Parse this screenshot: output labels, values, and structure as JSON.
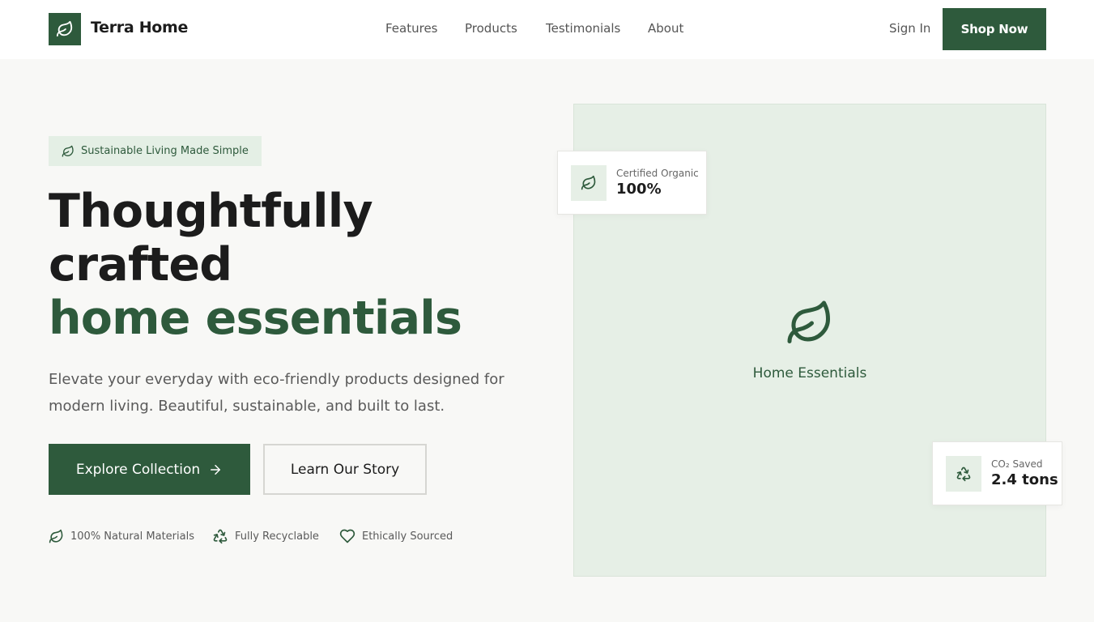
{
  "header": {
    "brand": "Terra Home",
    "nav": [
      "Features",
      "Products",
      "Testimonials",
      "About"
    ],
    "sign_in": "Sign In",
    "cta": "Shop Now"
  },
  "hero": {
    "tagline": "Sustainable Living Made Simple",
    "headline_line1": "Thoughtfully",
    "headline_line2": "crafted",
    "headline_line3": "home essentials",
    "subtext": "Elevate your everyday with eco-friendly products designed for modern living. Beautiful, sustainable, and built to last.",
    "primary_button": "Explore Collection",
    "secondary_button": "Learn Our Story",
    "features": [
      "100% Natural Materials",
      "Fully Recyclable",
      "Ethically Sourced"
    ]
  },
  "showcase": {
    "title": "Home Essentials",
    "badge_top": {
      "label": "Certified Organic",
      "value": "100%"
    },
    "badge_bottom": {
      "label": "CO₂ Saved",
      "value": "2.4 tons"
    }
  },
  "icons": {
    "logo": "leaf-icon",
    "tagline": "leaf-icon",
    "primary_button": "arrow-right-icon",
    "features": [
      "leaf-icon",
      "recycle-icon",
      "heart-icon"
    ],
    "showcase": "leaf-icon",
    "badge_top": "leaf-icon",
    "badge_bottom": "recycle-icon"
  },
  "colors": {
    "primary": "#2e5a3c",
    "background": "#f8f8f6",
    "accent_light": "#e6efe6"
  }
}
